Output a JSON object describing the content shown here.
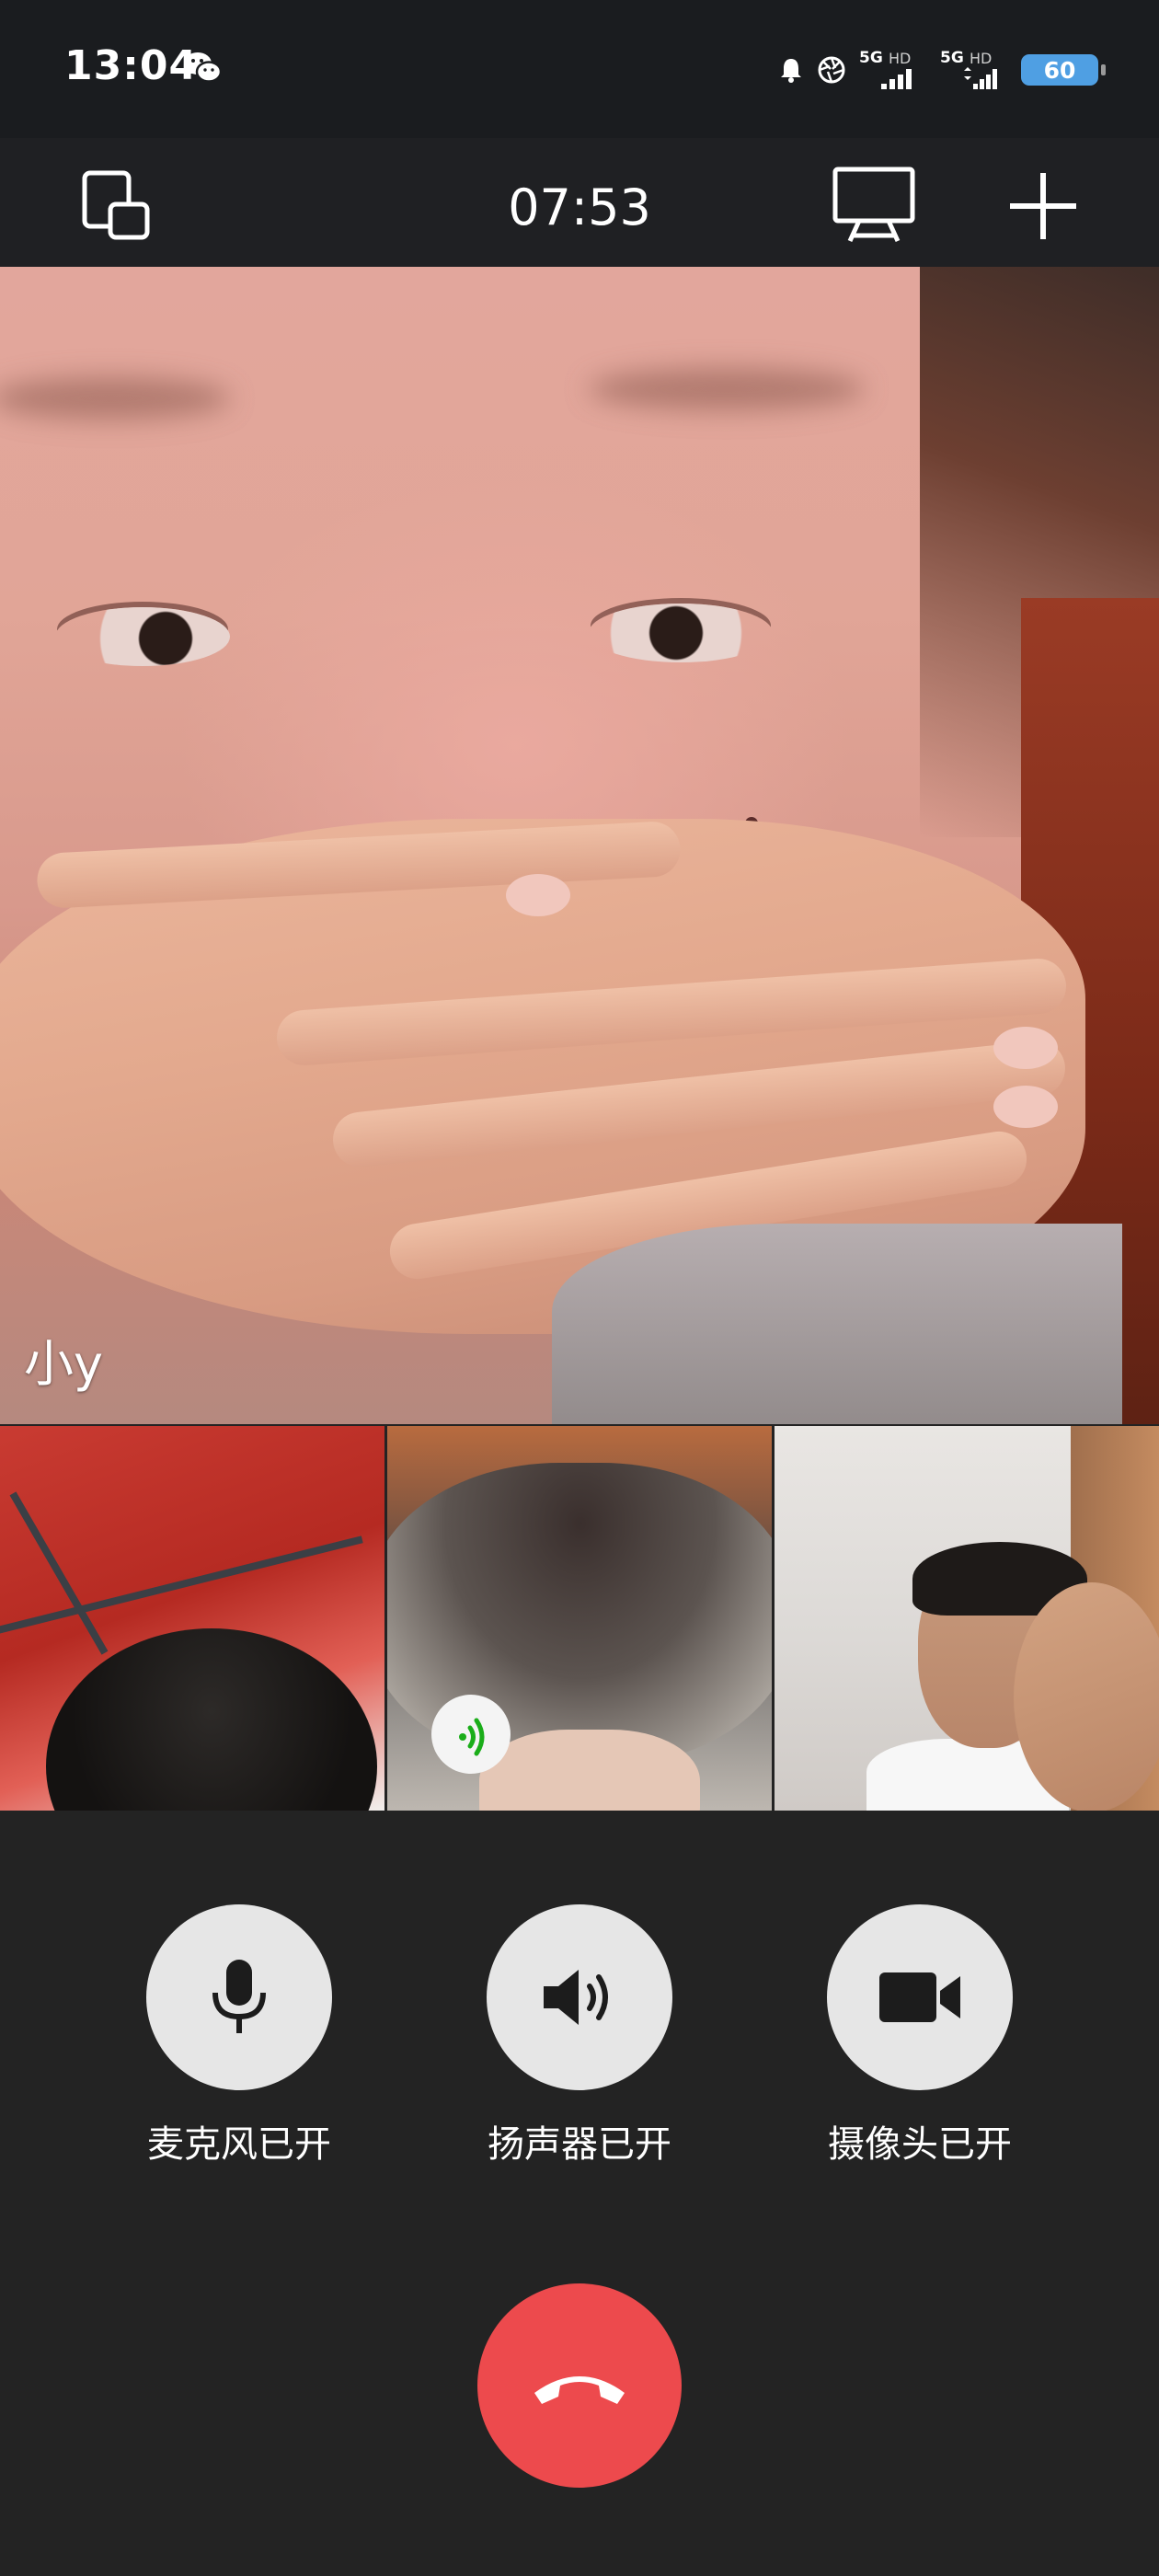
{
  "status_bar": {
    "time": "13:04",
    "network_1": {
      "type": "5G",
      "quality": "HD"
    },
    "network_2": {
      "type": "5G",
      "quality": "HD"
    },
    "battery_level": "60",
    "battery_color": "#4f9fe3"
  },
  "call_toolbar": {
    "duration": "07:53",
    "icons": [
      "minimize-window-icon",
      "screen-share-icon",
      "add-participant-icon"
    ]
  },
  "main_video": {
    "participant_name": "小y"
  },
  "thumbnails": [
    {
      "id": "participant-1",
      "speaking": false
    },
    {
      "id": "participant-2",
      "speaking": true,
      "indicator_color": "#1aad19"
    },
    {
      "id": "participant-3",
      "speaking": false
    }
  ],
  "controls": {
    "microphone_label": "麦克风已开",
    "speaker_label": "扬声器已开",
    "camera_label": "摄像头已开"
  },
  "hangup": {
    "color": "#ed4a4d",
    "icon": "hang-up-icon"
  }
}
